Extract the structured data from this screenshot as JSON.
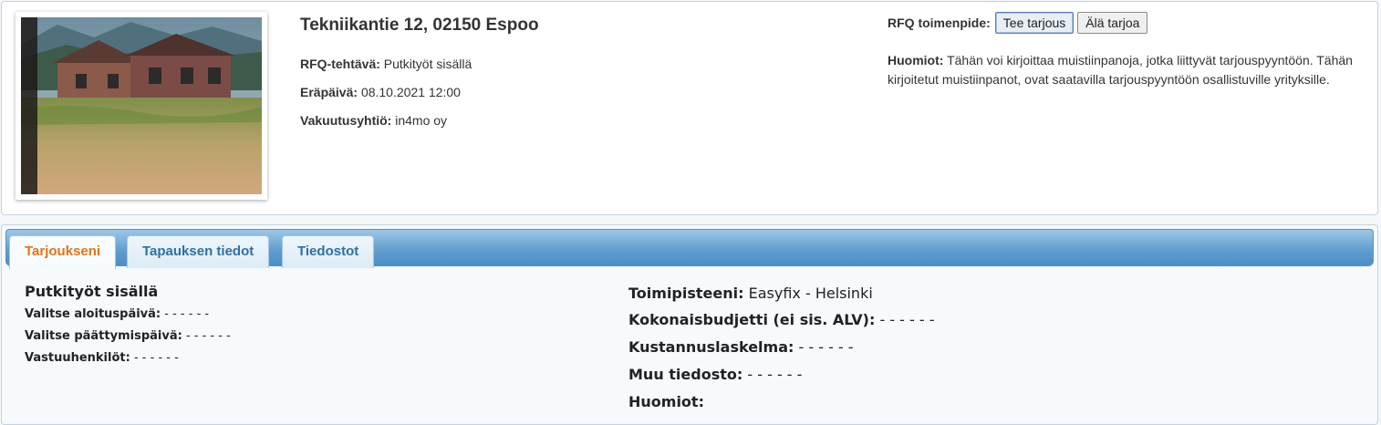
{
  "header": {
    "address": "Tekniikantie 12, 02150 Espoo",
    "rfq_task_label": "RFQ-tehtävä:",
    "rfq_task_value": "Putkityöt sisällä",
    "due_label": "Eräpäivä:",
    "due_value": "08.10.2021 12:00",
    "insurer_label": "Vakuutusyhtiö:",
    "insurer_value": "in4mo oy"
  },
  "rfq_action": {
    "label": "RFQ toimenpide:",
    "make_offer": "Tee tarjous",
    "no_offer": "Älä tarjoa"
  },
  "notes": {
    "label": "Huomiot:",
    "text": "Tähän voi kirjoittaa muistiinpanoja, jotka liittyvät tarjouspyyntöön. Tähän kirjoitetut muistiinpanot, ovat saatavilla tarjouspyyntöön osallistuville yrityksille."
  },
  "tabs": [
    {
      "label": "Tarjoukseni",
      "active": true
    },
    {
      "label": "Tapauksen tiedot",
      "active": false
    },
    {
      "label": "Tiedostot",
      "active": false
    }
  ],
  "offer": {
    "title": "Putkityöt sisällä",
    "start_label": "Valitse aloituspäivä:",
    "start_value": "- - - - - -",
    "end_label": "Valitse päättymispäivä:",
    "end_value": "- - - - - -",
    "responsible_label": "Vastuuhenkilöt:",
    "responsible_value": "- - - - - -",
    "office_label": "Toimipisteeni:",
    "office_value": "Easyfix - Helsinki",
    "budget_label": "Kokonaisbudjetti (ei sis. ALV):",
    "budget_value": "- - - - - -",
    "calc_label": "Kustannuslaskelma:",
    "calc_value": "- - - - - -",
    "other_label": "Muu tiedosto:",
    "other_value": "- - - - - -",
    "notes_label": "Huomiot:"
  }
}
